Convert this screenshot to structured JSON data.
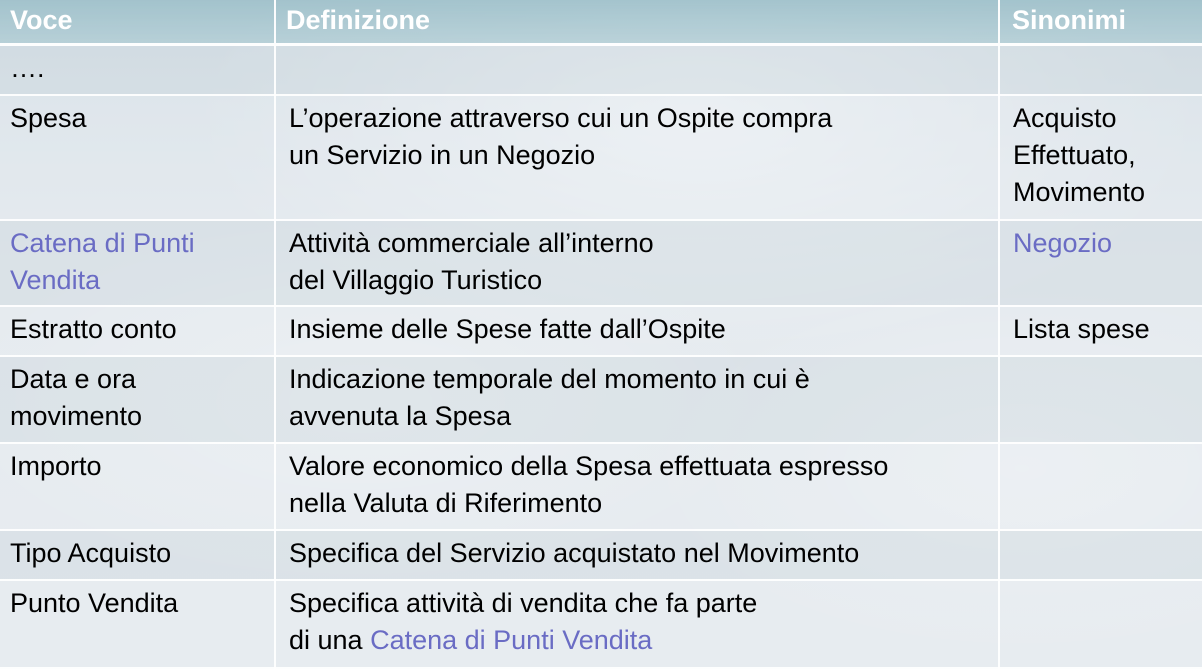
{
  "table": {
    "headers": {
      "voce": "Voce",
      "definizione": "Definizione",
      "sinonimi": "Sinonimi"
    },
    "rows": [
      {
        "voce": [
          "…."
        ],
        "definizione": [],
        "sinonimi": []
      },
      {
        "voce": [
          "Spesa"
        ],
        "definizione": [
          "L’operazione attraverso cui un Ospite compra",
          "un Servizio in un Negozio"
        ],
        "sinonimi": [
          "Acquisto",
          "Effettuato,",
          "Movimento"
        ]
      },
      {
        "voce": [
          "Catena di Punti",
          "Vendita"
        ],
        "definizione": [
          "Attività commerciale all’interno",
          "del Villaggio Turistico"
        ],
        "sinonimi": [
          "Negozio"
        ]
      },
      {
        "voce": [
          "Estratto conto"
        ],
        "definizione": [
          "Insieme delle Spese fatte dall’Ospite"
        ],
        "sinonimi": [
          "Lista spese"
        ]
      },
      {
        "voce": [
          "Data e ora",
          "movimento"
        ],
        "definizione": [
          "Indicazione temporale del momento in cui è",
          "avvenuta la Spesa"
        ],
        "sinonimi": []
      },
      {
        "voce": [
          "Importo"
        ],
        "definizione": [
          "Valore economico della Spesa effettuata espresso",
          "nella Valuta di Riferimento"
        ],
        "sinonimi": []
      },
      {
        "voce": [
          "Tipo Acquisto"
        ],
        "definizione": [
          "Specifica del Servizio acquistato nel Movimento"
        ],
        "sinonimi": []
      },
      {
        "voce": [
          "Punto Vendita"
        ],
        "definizione_line1": "Specifica attività di vendita che fa parte",
        "definizione_line2_prefix": "di una ",
        "definizione_line2_link": "Catena di Punti Vendita",
        "sinonimi": []
      }
    ]
  },
  "colors": {
    "link": "#6a6cc4",
    "header_text": "#ffffff",
    "header_bg": "#9abec8"
  }
}
